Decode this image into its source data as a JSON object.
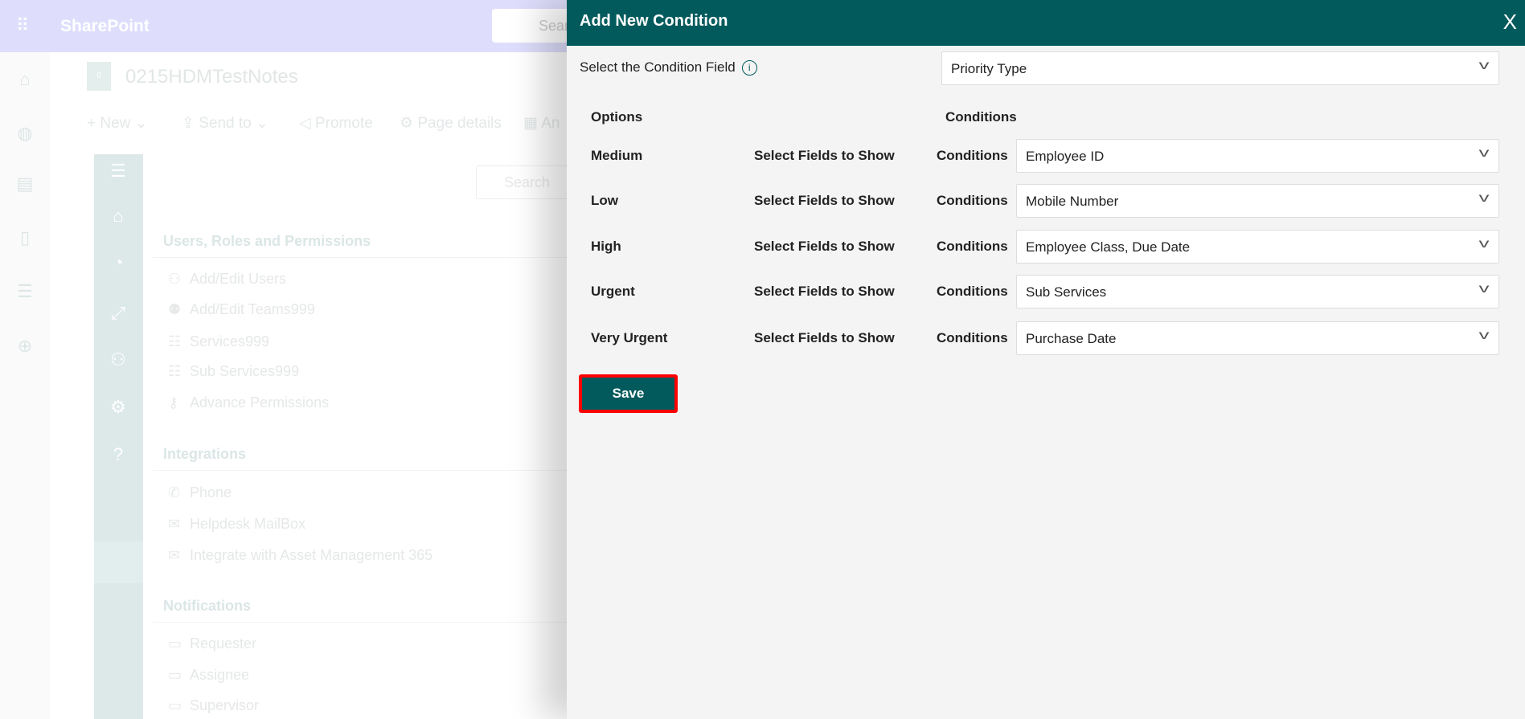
{
  "background": {
    "app_name": "SharePoint",
    "search_placeholder": "Search",
    "page_name": "0215HDMTestNotes",
    "page_logo_letter": "0",
    "commands": [
      "New",
      "Send to",
      "Promote",
      "Page details",
      "An"
    ],
    "content_search_placeholder": "Search",
    "sections": [
      {
        "title": "Users, Roles and Permissions",
        "items": [
          {
            "label": "Add/Edit Users",
            "icon": "users-icon"
          },
          {
            "label": "Add/Edit Teams999",
            "icon": "teams-icon"
          },
          {
            "label": "Services999",
            "icon": "list-icon"
          },
          {
            "label": "Sub Services999",
            "icon": "sublist-icon"
          },
          {
            "label": "Advance Permissions",
            "icon": "key-icon"
          }
        ]
      },
      {
        "title": "Integrations",
        "items": [
          {
            "label": "Phone",
            "icon": "phone-icon"
          },
          {
            "label": "Helpdesk MailBox",
            "icon": "mail-icon"
          },
          {
            "label": "Integrate with Asset Management 365",
            "icon": "mail-settings-icon"
          }
        ]
      },
      {
        "title": "Notifications",
        "items": [
          {
            "label": "Requester",
            "icon": "alert-comment-icon"
          },
          {
            "label": "Assignee",
            "icon": "alert-comment-icon"
          },
          {
            "label": "Supervisor",
            "icon": "alert-comment-icon"
          }
        ]
      }
    ],
    "side_help": "?"
  },
  "panel": {
    "title": "Add New Condition",
    "close": "X",
    "condition_field_label": "Select the Condition Field",
    "condition_field_value": "Priority Type",
    "options_header": "Options",
    "conditions_header": "Conditions",
    "rows": [
      {
        "option": "Medium",
        "action": "Select Fields to Show",
        "cond_label": "Conditions",
        "value": "Employee ID"
      },
      {
        "option": "Low",
        "action": "Select Fields to Show",
        "cond_label": "Conditions",
        "value": "Mobile Number"
      },
      {
        "option": "High",
        "action": "Select Fields to Show",
        "cond_label": "Conditions",
        "value": "Employee Class, Due Date"
      },
      {
        "option": "Urgent",
        "action": "Select Fields to Show",
        "cond_label": "Conditions",
        "value": "Sub Services"
      },
      {
        "option": "Very Urgent",
        "action": "Select Fields to Show",
        "cond_label": "Conditions",
        "value": "Purchase Date"
      }
    ],
    "save_label": "Save"
  },
  "colors": {
    "accent": "#025a5c",
    "highlight": "#ff0000"
  }
}
